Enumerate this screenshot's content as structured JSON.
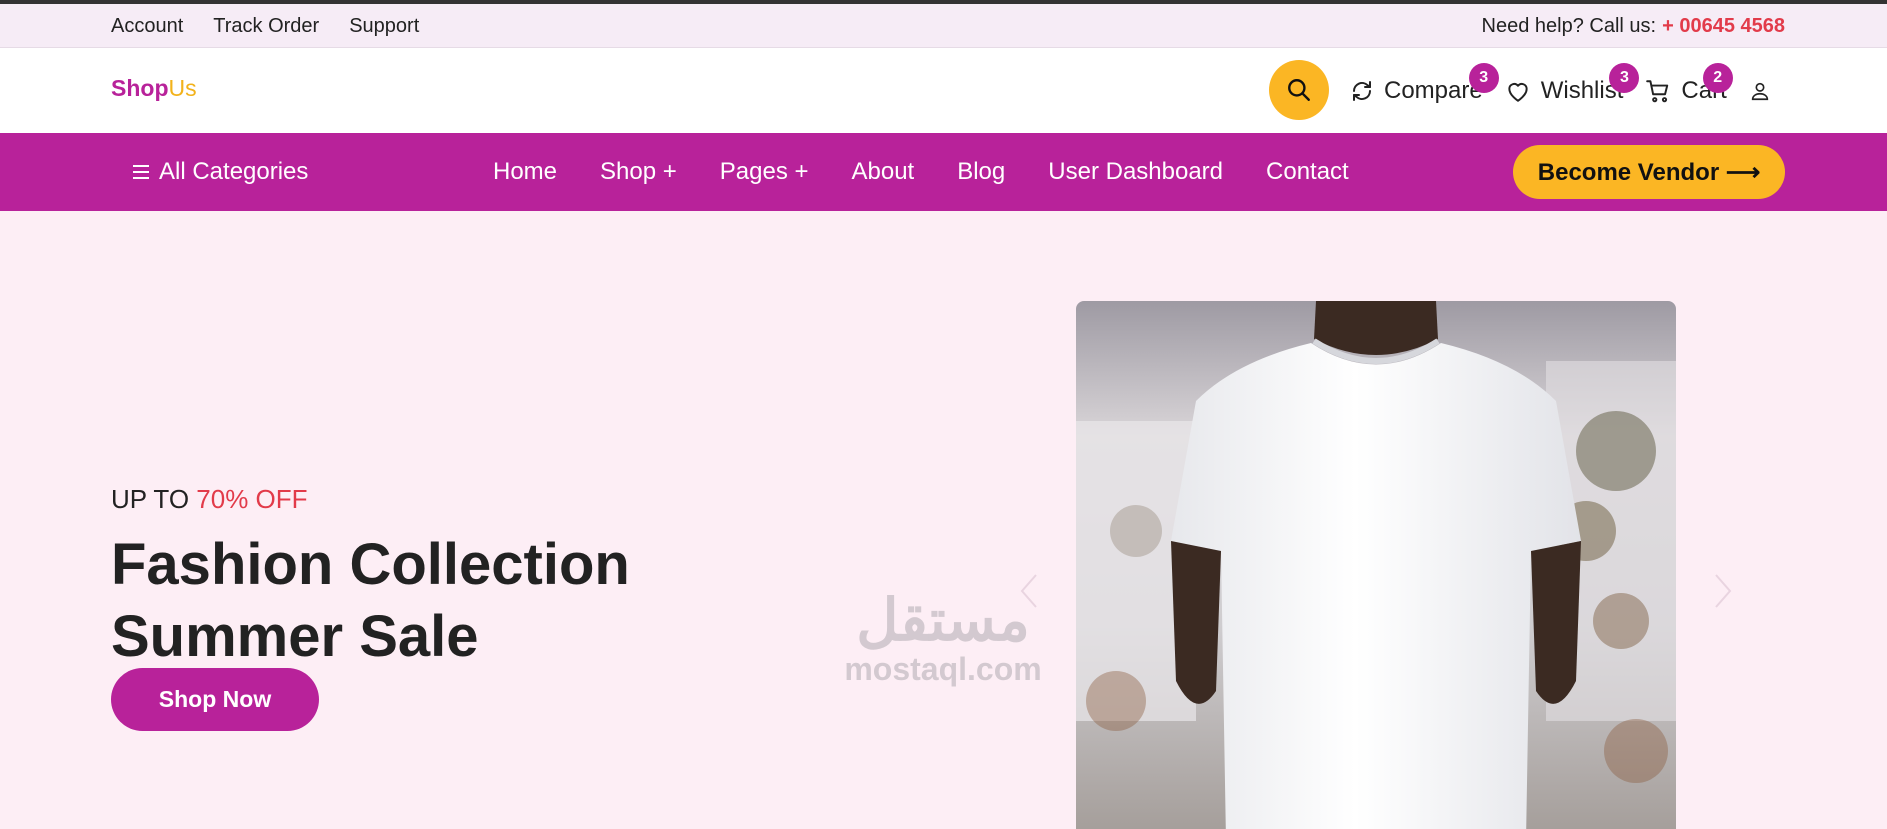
{
  "topbar": {
    "links": [
      "Account",
      "Track Order",
      "Support"
    ],
    "help_text": "Need help? Call us:",
    "phone": "+ 00645 4568"
  },
  "header": {
    "logo_part1": "Shop",
    "logo_part2": "Us",
    "compare": {
      "label": "Compare",
      "count": "3"
    },
    "wishlist": {
      "label": "Wishlist",
      "count": "3"
    },
    "cart": {
      "label": "Cart",
      "count": "2"
    }
  },
  "nav": {
    "all_categories": "All Categories",
    "items": [
      "Home",
      "Shop +",
      "Pages +",
      "About",
      "Blog",
      "User Dashboard",
      "Contact"
    ],
    "vendor_button": "Become Vendor ⟶"
  },
  "hero": {
    "promo_prefix": "UP TO",
    "promo_highlight": "70% OFF",
    "title_line1": "Fashion Collection",
    "title_line2": "Summer Sale",
    "cta": "Shop Now"
  },
  "watermark": {
    "arabic": "مستقل",
    "latin": "mostaql.com"
  },
  "colors": {
    "brand": "#b8229a",
    "accent": "#fbb624",
    "highlight": "#e23b4a",
    "hero_bg": "#fdeef5"
  }
}
